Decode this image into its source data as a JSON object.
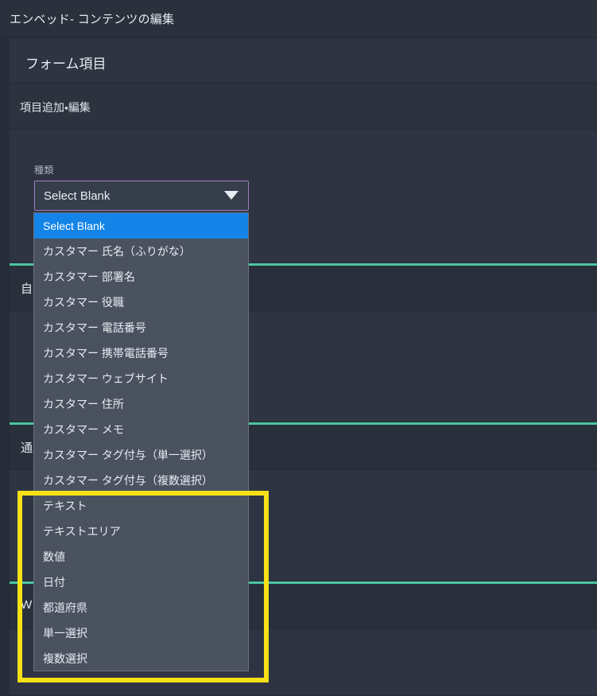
{
  "window": {
    "title": "エンベッド- コンテンツの編集"
  },
  "page": {
    "heading": "フォーム項目",
    "subheading": "項目追加・編集"
  },
  "field": {
    "label": "種類",
    "select": {
      "value": "Select Blank",
      "caret_icon": "chevron-down-icon",
      "expanded": true,
      "options": [
        "Select Blank",
        "カスタマー 氏名（ふりがな）",
        "カスタマー 部署名",
        "カスタマー 役職",
        "カスタマー 電話番号",
        "カスタマー 携帯電話番号",
        "カスタマー ウェブサイト",
        "カスタマー 住所",
        "カスタマー メモ",
        "カスタマー タグ付与（単一選択）",
        "カスタマー タグ付与（複数選択）",
        "テキスト",
        "テキストエリア",
        "数値",
        "日付",
        "都道府県",
        "単一選択",
        "複数選択"
      ],
      "selected_index": 0
    }
  },
  "sections": [
    {
      "label": "自"
    },
    {
      "label": "通"
    },
    {
      "label": "W"
    }
  ],
  "colors": {
    "window_bg": "#272d38",
    "panel_bg": "#2e3442",
    "topbar_bg": "#2a303c",
    "accent_green": "#4ac7a2",
    "option_selected": "#1484e8",
    "listbox_bg": "#4a5260",
    "select_focus_border": "#9f7fc4",
    "highlight_yellow": "#f7e018",
    "text_primary": "#e7ebf1",
    "text_muted": "#aab3c2"
  },
  "annotation": {
    "name": "highlight-rectangle",
    "color": "#f7e018"
  }
}
